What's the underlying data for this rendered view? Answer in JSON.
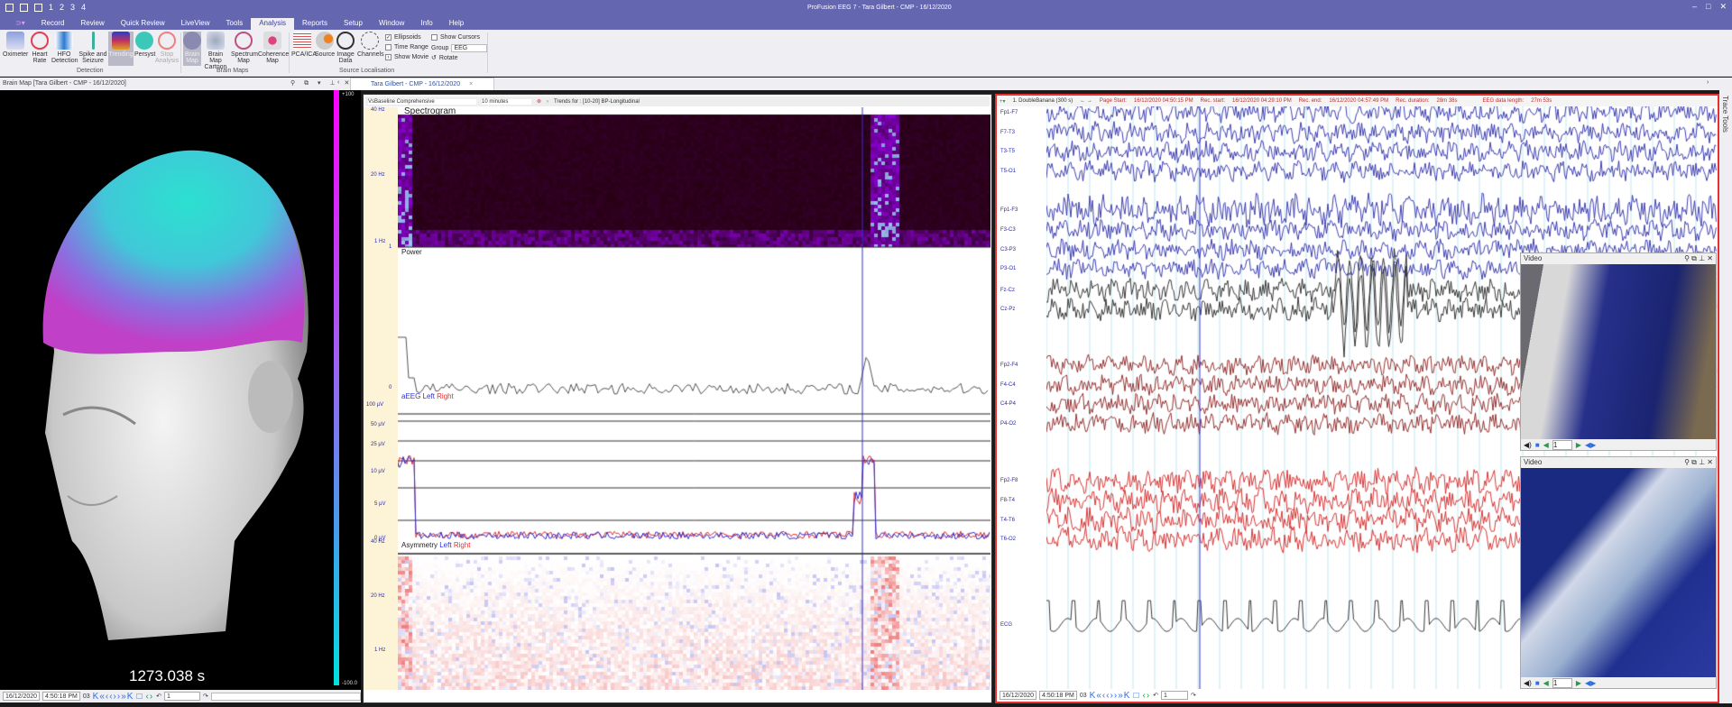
{
  "app": {
    "title": "ProFusion EEG 7 - Tara Gilbert - CMP - 16/12/2020",
    "quick_access": [
      "1",
      "2",
      "3",
      "4"
    ]
  },
  "menu_tabs": [
    "Record",
    "Review",
    "Quick Review",
    "LiveView",
    "Tools",
    "Analysis",
    "Reports",
    "Setup",
    "Window",
    "Info",
    "Help"
  ],
  "active_tab": "Analysis",
  "ribbon": {
    "detection": {
      "label": "Detection",
      "buttons": [
        "Oximeter",
        "Heart Rate",
        "HFO Detection",
        "Spike and Seizure",
        "Trending",
        "Persyst",
        "Stop Analysis"
      ]
    },
    "brain_maps": {
      "label": "Brain Maps",
      "buttons": [
        "Brain Map",
        "Brain Map Cartoon",
        "Spectrum Map",
        "Coherence Map"
      ]
    },
    "source": {
      "label": "Source Localisation",
      "buttons": [
        "PCA/ICA",
        "Source",
        "Image Data",
        "Channels"
      ],
      "checks": [
        {
          "label": "Ellipsoids",
          "checked": true
        },
        {
          "label": "Time Range",
          "checked": false
        },
        {
          "label": "Show Movie",
          "checked": false
        },
        {
          "label": "Show Cursors",
          "checked": false
        }
      ],
      "group_label": "Group",
      "group_value": "EEG",
      "rotate": "Rotate"
    }
  },
  "brain_panel": {
    "title": "Brain Map [Tara Gilbert - CMP - 16/12/2020]",
    "scale_max": "+100",
    "scale_min": "-100.0",
    "time": "1273.038 s"
  },
  "document_tab": "Tara Gilbert - CMP - 16/12/2020",
  "trend": {
    "profile": "VsBaseline Comprehensive",
    "duration": "10 minutes",
    "trends_for": "Trends for : [10-20] BP-Longitudinal",
    "spectrogram": {
      "title": "Spectrogram",
      "ticks": [
        "40 Hz",
        "20 Hz",
        "1 Hz"
      ]
    },
    "power": {
      "title": "Power",
      "ticks": [
        "1",
        "0"
      ]
    },
    "aeeg": {
      "title": "aEEG",
      "left": "Left",
      "right": "Right",
      "ticks": [
        "100 µV",
        "50 µV",
        "25 µV",
        "10 µV",
        "5 µV",
        "0 µV"
      ]
    },
    "asymmetry": {
      "title": "Asymmetry",
      "left": "Left",
      "right": "Right",
      "ticks": [
        "40 Hz",
        "20 Hz",
        "1 Hz"
      ]
    }
  },
  "nav": {
    "date": "16/12/2020",
    "time": "4:50:18 PM",
    "page": "03",
    "page_field": "1"
  },
  "eeg": {
    "montage": "1. DoubleBanana (300 s)",
    "page_start_label": "Page Start:",
    "page_start": "16/12/2020 04:50:15 PM",
    "rec_start_label": "Rec. start:",
    "rec_start": "16/12/2020 04:29:10 PM",
    "rec_end_label": "Rec. end:",
    "rec_end": "16/12/2020 04:57:49 PM",
    "rec_duration_label": "Rec. duration:",
    "rec_duration": "28m 38s",
    "data_length_label": "EEG data length:",
    "data_length": "27m 53s",
    "channels": [
      "Fp1-F7",
      "F7-T3",
      "T3-T5",
      "T5-O1",
      "Fp1-F3",
      "F3-C3",
      "C3-P3",
      "P3-O1",
      "Fz-Cz",
      "Cz-Pz",
      "Fp2-F4",
      "F4-C4",
      "C4-P4",
      "P4-O2",
      "Fp2-F8",
      "F8-T4",
      "T4-T6",
      "T6-O2",
      "ECG"
    ]
  },
  "videos": [
    {
      "title": "Video",
      "frame": "1"
    },
    {
      "title": "Video",
      "frame": "1"
    }
  ],
  "trace_tools": "Trace Tools",
  "colors": {
    "titlebar": "#6466b0",
    "blue_trace": "#2a2aa8",
    "dark_red_trace": "#8a1c1c",
    "red_trace": "#d42020",
    "cursor": "#3030d0"
  }
}
